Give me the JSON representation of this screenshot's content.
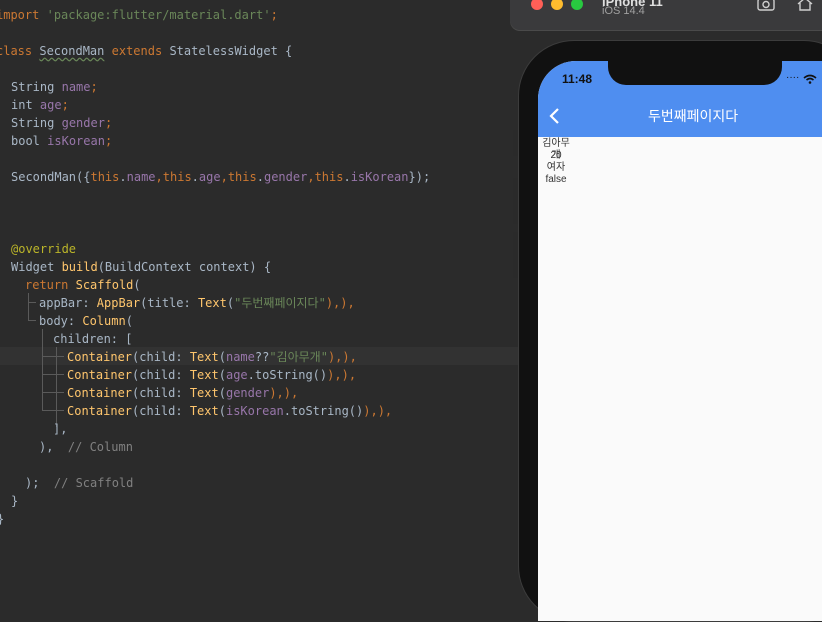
{
  "editor": {
    "lines": {
      "l1": {
        "kw": "import",
        "str": "'package:flutter/material.dart'",
        "end": ";"
      },
      "l2": {
        "kw1": "class",
        "name": "SecondMan",
        "kw2": "extends",
        "base": "StatelessWidget {"
      },
      "l3": {
        "type": "String",
        "field": "name",
        "end": ";"
      },
      "l4": {
        "type": "int",
        "field": "age",
        "end": ";"
      },
      "l5": {
        "type": "String",
        "field": "gender",
        "end": ";"
      },
      "l6": {
        "type": "bool",
        "field": "isKorean",
        "end": ";"
      },
      "l7": {
        "a": "SecondMan({",
        "t1": "this",
        "d1": ".",
        "f1": "name",
        "c1": ",",
        "t2": "this",
        "d2": ".",
        "f2": "age",
        "c2": ",",
        "t3": "this",
        "d3": ".",
        "f3": "gender",
        "c3": ",",
        "t4": "this",
        "d4": ".",
        "f4": "isKorean",
        "end": "});"
      },
      "l8": {
        "ann": "@override"
      },
      "l9": {
        "a": "Widget ",
        "fn": "build",
        "b": "(BuildContext context) {"
      },
      "l10": {
        "kw": "return",
        "cls": "Scaffold",
        "end": "("
      },
      "l11": {
        "p": "appBar: ",
        "c1": "AppBar",
        "a": "(title: ",
        "c2": "Text",
        "b": "(",
        "str": "\"두번째페이지다\"",
        "end": "),),"
      },
      "l12": {
        "p": "body: ",
        "c1": "Column",
        "end": "("
      },
      "l13": {
        "p": "children: ["
      },
      "l14": {
        "c1": "Container",
        "a": "(child: ",
        "c2": "Text",
        "b": "(",
        "fld": "name",
        "op": "??",
        "str": "\"김아무개\"",
        "end": "),),"
      },
      "l15": {
        "c1": "Container",
        "a": "(child: ",
        "c2": "Text",
        "b": "(",
        "fld": "age",
        "m": ".toString()",
        "end": "),),"
      },
      "l16": {
        "c1": "Container",
        "a": "(child: ",
        "c2": "Text",
        "b": "(",
        "fld": "gender",
        "end": "),),"
      },
      "l17": {
        "c1": "Container",
        "a": "(child: ",
        "c2": "Text",
        "b": "(",
        "fld": "isKorean",
        "m": ".toString()",
        "end": "),),"
      },
      "l18": {
        "a": "],"
      },
      "l19": {
        "a": "),",
        "cmt": "// Column"
      },
      "l20": {
        "a": ");",
        "cmt": "// Scaffold"
      },
      "l21": {
        "a": "}"
      },
      "l22": {
        "a": "}"
      }
    }
  },
  "simulator": {
    "title": "iPhone 11",
    "subtitle": "iOS 14.4",
    "traffic_colors": {
      "close": "#ff5f57",
      "minimize": "#febc2e",
      "zoom": "#28c840"
    },
    "toolbar_icons": [
      "camera-icon",
      "home-icon"
    ]
  },
  "phone": {
    "status_time": "11:48",
    "app_bar_title": "두번째페이지다",
    "app_bar_color": "#4f8ef0",
    "back_icon": "chevron-left-icon",
    "body_texts": [
      "김아무개",
      "20",
      "여자",
      "false"
    ]
  }
}
